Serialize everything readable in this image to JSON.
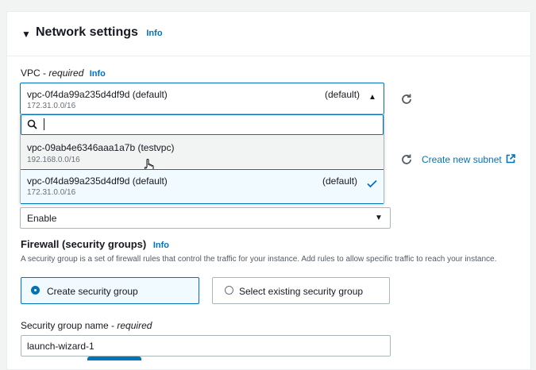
{
  "section": {
    "title": "Network settings",
    "info": "Info"
  },
  "vpc": {
    "label": "VPC - ",
    "required": "required",
    "info": "Info",
    "selected_id": "vpc-0f4da99a235d4df9d (default)",
    "selected_cidr": "172.31.0.0/16",
    "selected_tag": "(default)",
    "search_value": "",
    "options": [
      {
        "id": "vpc-09ab4e6346aaa1a7b (testvpc)",
        "cidr": "192.168.0.0/16",
        "tag": ""
      },
      {
        "id": "vpc-0f4da99a235d4df9d (default)",
        "cidr": "172.31.0.0/16",
        "tag": "(default)"
      }
    ]
  },
  "subnet": {
    "create_link": "Create new subnet"
  },
  "auto_assign_ip": {
    "value": "Enable"
  },
  "firewall": {
    "title": "Firewall (security groups)",
    "info": "Info",
    "description": "A security group is a set of firewall rules that control the traffic for your instance. Add rules to allow specific traffic to reach your instance.",
    "option_create": "Create security group",
    "option_existing": "Select existing security group",
    "selected": "create"
  },
  "security_group_name": {
    "label": "Security group name - ",
    "required": "required",
    "value": "launch-wizard-1"
  },
  "colors": {
    "accent": "#0073bb",
    "text": "#16191f",
    "border": "#aab7b8"
  }
}
